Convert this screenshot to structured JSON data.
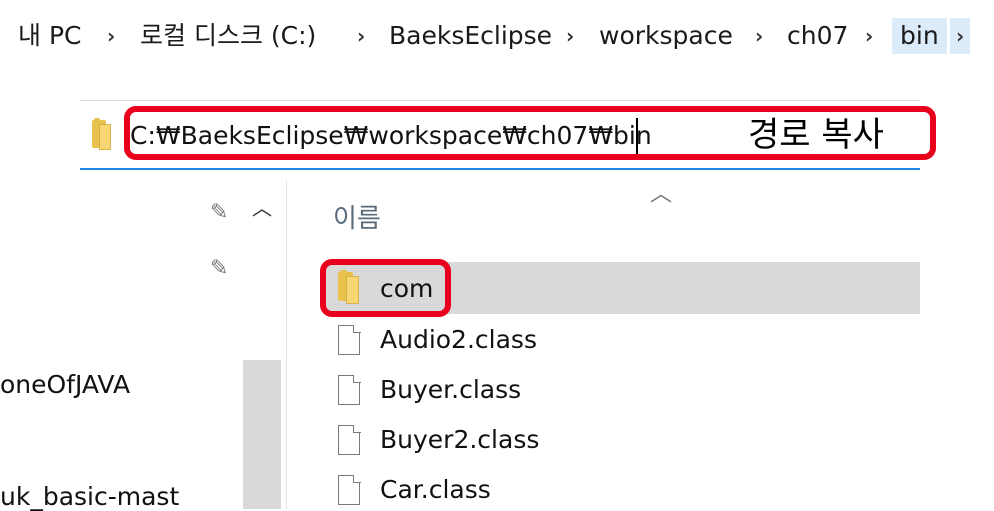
{
  "breadcrumb": {
    "items": [
      "내 PC",
      "로컬 디스크 (C:)",
      "BaeksEclipse",
      "workspace",
      "ch07",
      "bin"
    ],
    "separator": "›"
  },
  "address_bar": {
    "path": "C:₩BaeksEclipse₩workspace₩ch07₩bin"
  },
  "annotation": {
    "text": "경로 복사",
    "highlight_color": "#e8001c"
  },
  "nav_pane": {
    "items": [
      "oneOfJAVA",
      "uk_basic-mast"
    ],
    "icons": [
      "pin-icon",
      "pin-icon",
      "chevron-up-icon"
    ]
  },
  "file_list": {
    "column_header": "이름",
    "items": [
      {
        "name": "com",
        "type": "folder",
        "selected": true
      },
      {
        "name": "Audio2.class",
        "type": "file"
      },
      {
        "name": "Buyer.class",
        "type": "file"
      },
      {
        "name": "Buyer2.class",
        "type": "file"
      },
      {
        "name": "Car.class",
        "type": "file"
      }
    ]
  },
  "colors": {
    "accent": "#1e88e5",
    "selection": "#d9d9d9",
    "current_crumb": "#dcebfa",
    "folder": "#f6d774"
  }
}
